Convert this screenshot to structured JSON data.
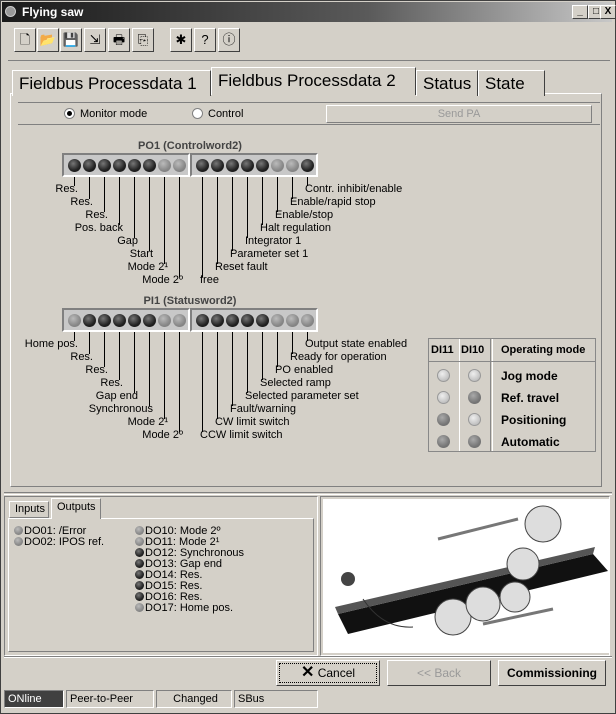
{
  "window": {
    "title": "Flying saw",
    "controls": [
      "_",
      "□",
      "X"
    ]
  },
  "toolbar": {
    "icons": [
      "new-file-icon",
      "open-folder-icon",
      "save-icon",
      "export-icon",
      "print-icon",
      "copy-icon",
      "bug-icon",
      "help-icon",
      "info-icon"
    ],
    "glyphs": [
      "🗋",
      "📂",
      "💾",
      "⇲",
      "🖶",
      "⎘",
      "✱",
      "?",
      "ⓘ"
    ]
  },
  "tabs": [
    {
      "label": "Fieldbus Processdata 1"
    },
    {
      "label": "Fieldbus Processdata 2",
      "active": true
    },
    {
      "label": "Status"
    },
    {
      "label": "State"
    }
  ],
  "mode": {
    "monitor_label": "Monitor mode",
    "control_label": "Control",
    "selected": "Monitor mode",
    "send_label": "Send PA"
  },
  "po1": {
    "title": "PO1 (Controlword2)",
    "leds": [
      "on",
      "on",
      "on",
      "on",
      "on",
      "on",
      "off",
      "off",
      "on",
      "on",
      "on",
      "on",
      "on",
      "off",
      "off",
      "on"
    ],
    "labels": [
      "Res.",
      "Res.",
      "Res.",
      "Pos. back",
      "Gap",
      "Start",
      "Mode 2¹",
      "Mode 2º",
      "free",
      "Reset fault",
      "Parameter set 1",
      "Integrator 1",
      "Halt regulation",
      "Enable/stop",
      "Enable/rapid stop",
      "Contr. inhibit/enable"
    ]
  },
  "pi1": {
    "title": "PI1 (Statusword2)",
    "leds": [
      "off",
      "on",
      "on",
      "on",
      "on",
      "on",
      "off",
      "off",
      "on",
      "on",
      "on",
      "on",
      "on",
      "off",
      "off",
      "off"
    ],
    "labels": [
      "Home pos.",
      "Res.",
      "Res.",
      "Res.",
      "Gap end",
      "Synchronous",
      "Mode 2¹",
      "Mode 2º",
      "CCW limit switch",
      "CW limit switch",
      "Fault/warning",
      "Selected parameter set",
      "Selected ramp",
      "PO enabled",
      "Ready for operation",
      "Output state enabled"
    ]
  },
  "opmode": {
    "headers": [
      "DI11",
      "DI10",
      "Operating mode"
    ],
    "rows": [
      {
        "di11": "off",
        "di10": "off",
        "mode": "Jog mode"
      },
      {
        "di11": "off",
        "di10": "on",
        "mode": "Ref. travel"
      },
      {
        "di11": "on",
        "di10": "off",
        "mode": "Positioning"
      },
      {
        "di11": "on",
        "di10": "on",
        "mode": "Automatic"
      }
    ]
  },
  "io": {
    "tabs": [
      "Inputs",
      "Outputs"
    ],
    "active_tab": "Outputs",
    "col1": [
      {
        "label": "DO01: /Error",
        "state": "off"
      },
      {
        "label": "DO02: IPOS ref.",
        "state": "off"
      }
    ],
    "col2": [
      {
        "label": "DO10: Mode 2º",
        "state": "off"
      },
      {
        "label": "DO11: Mode 2¹",
        "state": "off"
      },
      {
        "label": "DO12: Synchronous",
        "state": "on"
      },
      {
        "label": "DO13: Gap end",
        "state": "on"
      },
      {
        "label": "DO14: Res.",
        "state": "on"
      },
      {
        "label": "DO15: Res.",
        "state": "on"
      },
      {
        "label": "DO16: Res.",
        "state": "on"
      },
      {
        "label": "DO17: Home pos.",
        "state": "off"
      }
    ]
  },
  "buttons": {
    "cancel": "Cancel",
    "back": "<< Back",
    "commissioning": "Commissioning"
  },
  "status": [
    "ONline",
    "Peer-to-Peer",
    "Changed",
    "SBus"
  ]
}
